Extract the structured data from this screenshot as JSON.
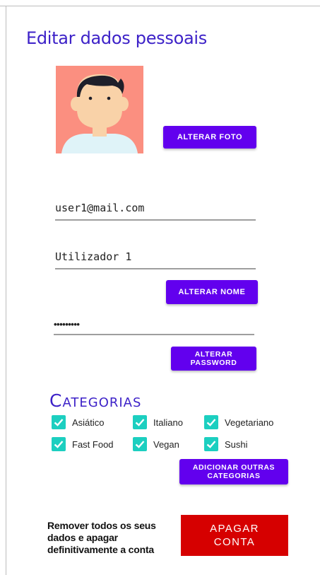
{
  "page": {
    "title": "Editar dados pessoais"
  },
  "profile": {
    "avatar_icon": "avatar-illustration",
    "change_photo_label": "ALTERAR FOTO"
  },
  "email": {
    "value": "user1@mail.com"
  },
  "name": {
    "value": "Utilizador 1",
    "change_label": "ALTERAR NOME"
  },
  "password": {
    "value": "•••••••••",
    "change_label_line1": "ALTERAR",
    "change_label_line2": "PASSWORD"
  },
  "categories": {
    "title": "Categorias",
    "items": [
      {
        "label": "Asiático",
        "checked": true
      },
      {
        "label": "Italiano",
        "checked": true
      },
      {
        "label": "Vegetariano",
        "checked": true
      },
      {
        "label": "Fast Food",
        "checked": true
      },
      {
        "label": "Vegan",
        "checked": true
      },
      {
        "label": "Sushi",
        "checked": true
      }
    ],
    "add_label_line1": "ADICIONAR OUTRAS",
    "add_label_line2": "CATEGORIAS"
  },
  "delete": {
    "warning": "Remover todos os seus dados e apagar definitivamente a conta",
    "button_line1": "APAGAR",
    "button_line2": "CONTA"
  },
  "colors": {
    "accent": "#6200ee",
    "title": "#3d22c8",
    "checkbox": "#1ccfc0",
    "danger": "#d60000"
  }
}
